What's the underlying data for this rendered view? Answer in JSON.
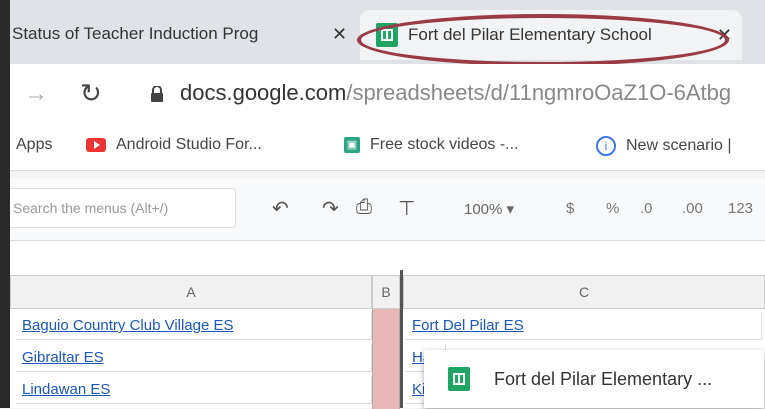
{
  "tabs": {
    "inactive_title": "Status of Teacher Induction Prog",
    "active_title": "Fort del Pilar Elementary School",
    "close_glyph": "✕"
  },
  "address": {
    "domain": "docs.google.com",
    "path": "/spreadsheets/d/11ngmroOaZ1O-6Atbg"
  },
  "bookmarks": [
    "Apps",
    "Android Studio For...",
    "Free stock videos -...",
    "New scenario |"
  ],
  "toolbar": {
    "search_placeholder": "Search the menus (Alt+/)",
    "zoom": "100%",
    "currency": "$",
    "percent": "%",
    "dec_minus": ".0",
    "dec_plus": ".00",
    "format": "123"
  },
  "sheet": {
    "columns": [
      "A",
      "B",
      "C"
    ],
    "col_a": [
      "Baguio Country Club Village ES",
      "Gibraltar ES",
      "Lindawan ES"
    ],
    "col_c": [
      "Fort Del Pilar ES",
      "Ha",
      "Ki"
    ]
  },
  "popup": {
    "label": "Fort del Pilar Elementary ..."
  },
  "colors": {
    "highlight": "#9b3a44",
    "link": "#1a57b8",
    "sheets_green": "#1fa463"
  }
}
